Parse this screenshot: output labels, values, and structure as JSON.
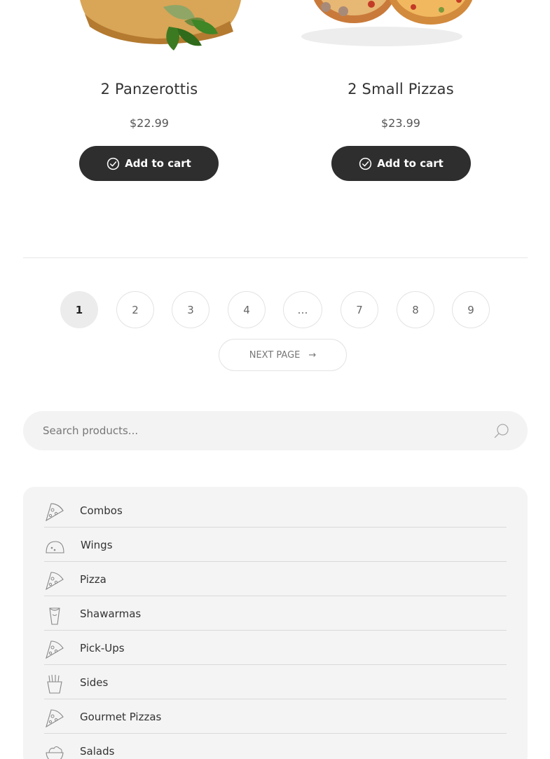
{
  "products": [
    {
      "title": "2 Panzerottis",
      "price": "$22.99",
      "button": "Add to cart"
    },
    {
      "title": "2 Small Pizzas",
      "price": "$23.99",
      "button": "Add to cart"
    }
  ],
  "pagination": {
    "pages": [
      "1",
      "2",
      "3",
      "4",
      "…",
      "7",
      "8",
      "9"
    ],
    "current": "1",
    "next_label": "Next page",
    "next_arrow": "→"
  },
  "search": {
    "placeholder": "Search products..."
  },
  "categories": [
    {
      "label": "Combos",
      "icon": "pizza-slice-icon"
    },
    {
      "label": "Wings",
      "icon": "wings-icon"
    },
    {
      "label": "Pizza",
      "icon": "pizza-slice-icon"
    },
    {
      "label": "Shawarmas",
      "icon": "shawarma-icon"
    },
    {
      "label": "Pick-Ups",
      "icon": "pizza-slice-icon"
    },
    {
      "label": "Sides",
      "icon": "fries-icon"
    },
    {
      "label": "Gourmet Pizzas",
      "icon": "pizza-slice-icon"
    },
    {
      "label": "Salads",
      "icon": "salad-bowl-icon"
    }
  ],
  "colors": {
    "button_dark": "#2e2e2e",
    "panel_bg": "#f4f4f4"
  }
}
